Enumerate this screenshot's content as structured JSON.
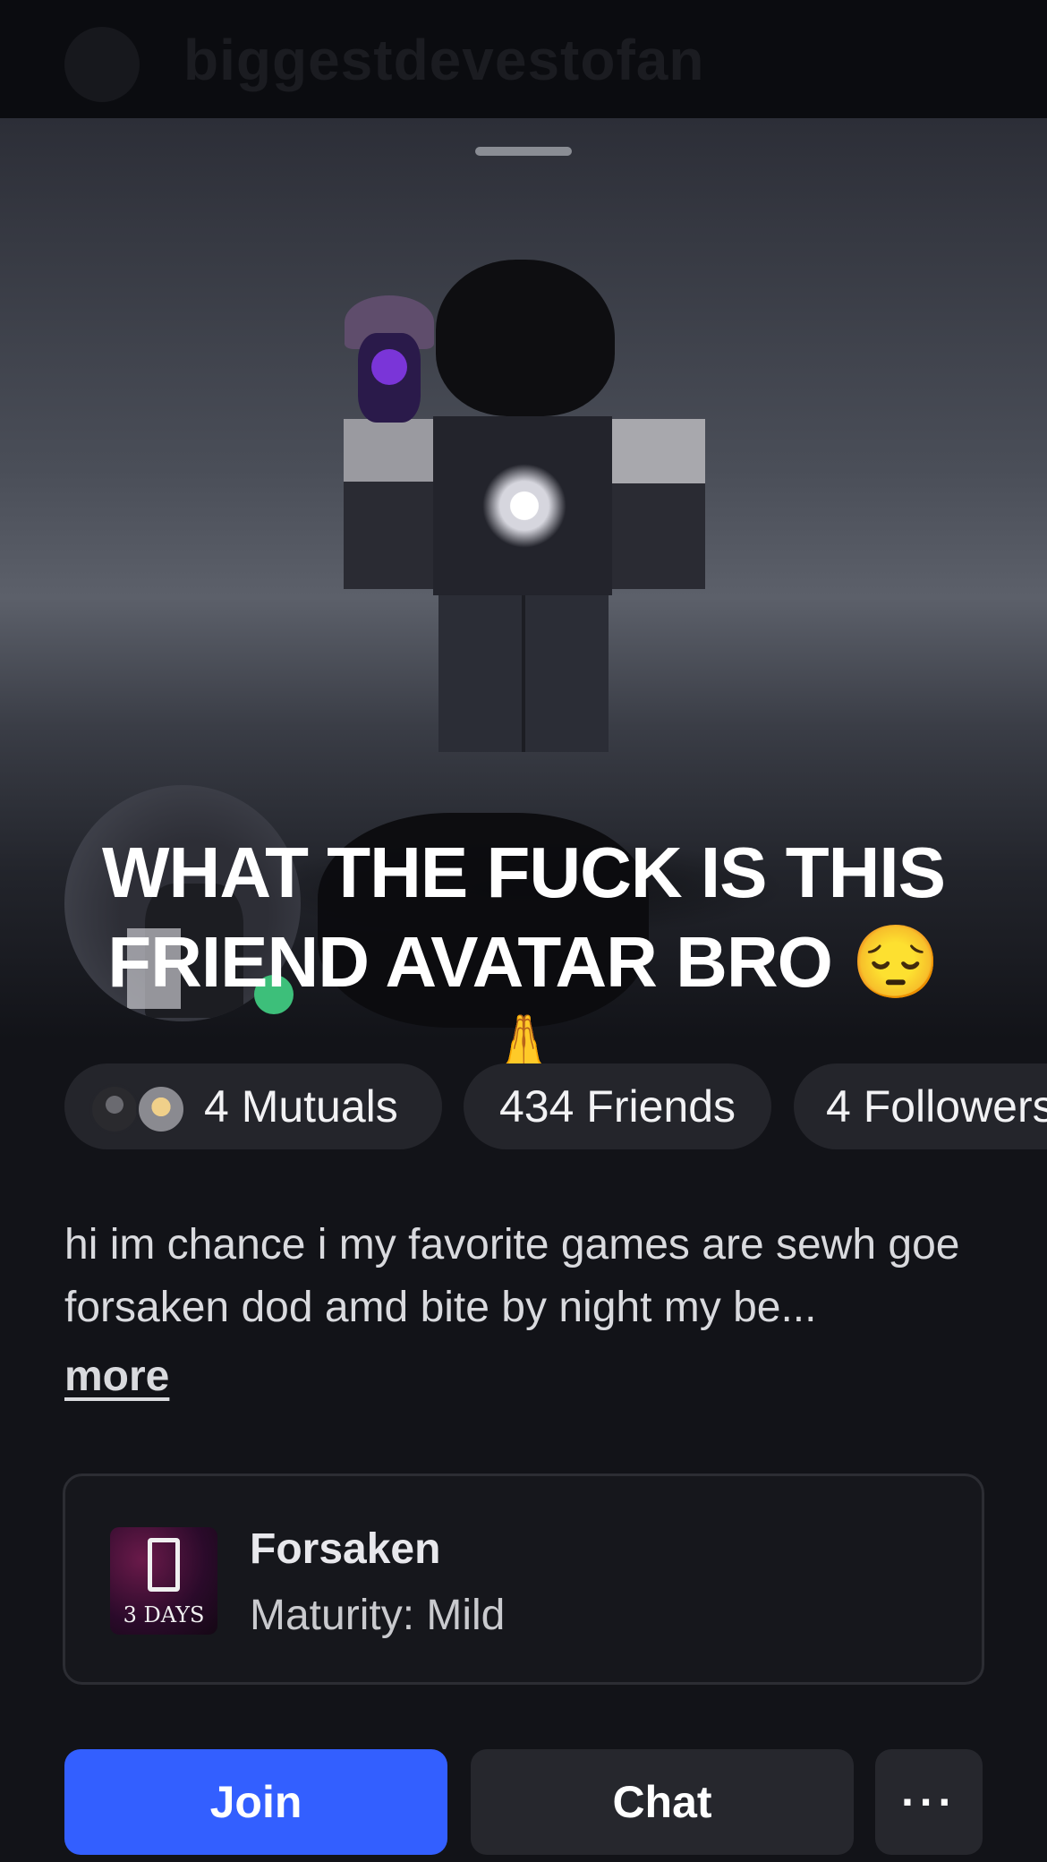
{
  "header": {
    "username": "biggestdevestofan"
  },
  "profile": {
    "display_name": "WHAT THE FUCK IS THIS FRIEND AVATAR BRO 😔🙏",
    "status": "online"
  },
  "stats": {
    "mutuals_label": "4 Mutuals",
    "friends_label": "434 Friends",
    "followers_label": "4 Followers"
  },
  "bio": {
    "text": "hi im chance i my favorite games are sewh goe forsaken dod amd bite by night my be...",
    "more_label": "more"
  },
  "game": {
    "name": "Forsaken",
    "maturity": "Maturity: Mild",
    "thumb_text": "3 DAYS"
  },
  "actions": {
    "join_label": "Join",
    "chat_label": "Chat",
    "more_label": "···"
  },
  "colors": {
    "join_button": "#335fff",
    "online_dot": "#3dbf7a",
    "background": "#121318"
  }
}
